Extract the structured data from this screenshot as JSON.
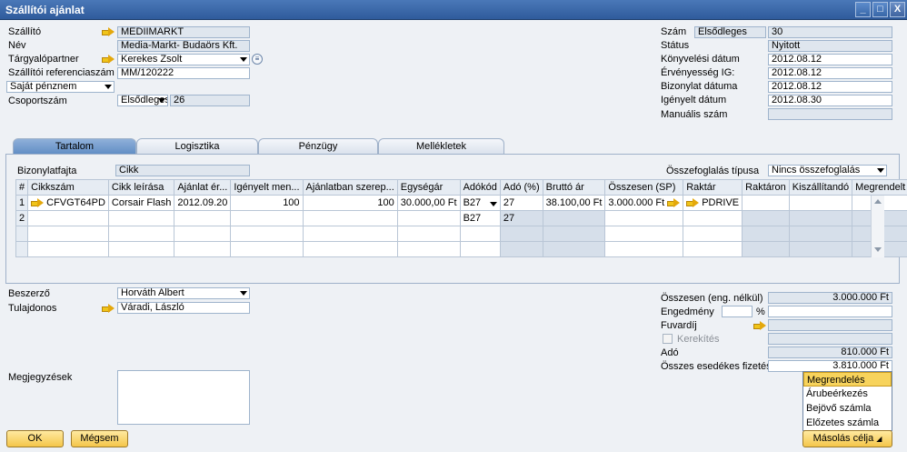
{
  "window": {
    "title": "Szállítói ajánlat",
    "min": "_",
    "max": "□",
    "close": "X"
  },
  "header_left": {
    "supplier_label": "Szállító",
    "supplier_value": "MEDIIMARKT",
    "name_label": "Név",
    "name_value": "Media-Markt- Budaörs Kft.",
    "contact_label": "Tárgyalópartner",
    "contact_value": "Kerekes Zsolt",
    "ref_label": "Szállítói referenciaszám",
    "ref_value": "MM/120222",
    "currency_value": "Saját pénznem",
    "series_label": "Csoportszám",
    "series_select": "Elsődleges",
    "series_value": "26"
  },
  "header_right": {
    "no_label": "Szám",
    "no_series": "Elsődleges",
    "no_value": "30",
    "status_label": "Státus",
    "status_value": "Nyitott",
    "posting_label": "Könyvelési dátum",
    "posting_value": "2012.08.12",
    "valid_label": "Érvényesség IG:",
    "valid_value": "2012.08.12",
    "docdate_label": "Bizonylat dátuma",
    "docdate_value": "2012.08.12",
    "reqdate_label": "Igényelt dátum",
    "reqdate_value": "2012.08.30",
    "manual_label": "Manuális szám"
  },
  "tabs": [
    "Tartalom",
    "Logisztika",
    "Pénzügy",
    "Mellékletek"
  ],
  "content": {
    "doctype_label": "Bizonylatfajta",
    "doctype_value": "Cikk",
    "summary_label": "Összefoglalás típusa",
    "summary_value": "Nincs összefoglalás",
    "columns": [
      "#",
      "Cikkszám",
      "Cikk leírása",
      "Ajánlat ér...",
      "Igényelt men...",
      "Ajánlatban szerep...",
      "Egységár",
      "Adókód",
      "Adó (%)",
      "Bruttó ár",
      "Összesen (SP)",
      "Raktár",
      "Raktáron",
      "Kiszállítandó",
      "Megrendelt"
    ],
    "rows": [
      [
        "1",
        "CFVGT64PD",
        "Corsair Flash",
        "2012.09.20",
        "100",
        "100",
        "30.000,00 Ft",
        "B27",
        "27",
        "38.100,00 Ft",
        "3.000.000 Ft",
        "PDRIVE",
        "",
        "",
        ""
      ],
      [
        "2",
        "",
        "",
        "",
        "",
        "",
        "",
        "B27",
        "27",
        "",
        "",
        "",
        "",
        "",
        ""
      ],
      [
        "",
        "",
        "",
        "",
        "",
        "",
        "",
        "",
        "",
        "",
        "",
        "",
        "",
        "",
        ""
      ],
      [
        "",
        "",
        "",
        "",
        "",
        "",
        "",
        "",
        "",
        "",
        "",
        "",
        "",
        "",
        ""
      ]
    ]
  },
  "footer_left": {
    "buyer_label": "Beszerző",
    "buyer_value": "Horváth Albert",
    "owner_label": "Tulajdonos",
    "owner_value": "Váradi, László",
    "remarks_label": "Megjegyzések"
  },
  "footer_right": {
    "total_label": "Összesen (eng. nélkül)",
    "total_value": "3.000.000 Ft",
    "discount_label": "Engedmény",
    "discount_pct": "%",
    "freight_label": "Fuvardíj",
    "rounding_label": "Kerekítés",
    "tax_label": "Adó",
    "tax_value": "810.000 Ft",
    "due_label": "Összes esedékes fizetés",
    "due_value": "3.810.000 Ft"
  },
  "buttons": {
    "ok": "OK",
    "cancel": "Mégsem",
    "copy_to": "Másolás célja"
  },
  "copy_menu": [
    "Megrendelés",
    "Árubeérkezés",
    "Bejövő számla",
    "Előzetes számla"
  ]
}
